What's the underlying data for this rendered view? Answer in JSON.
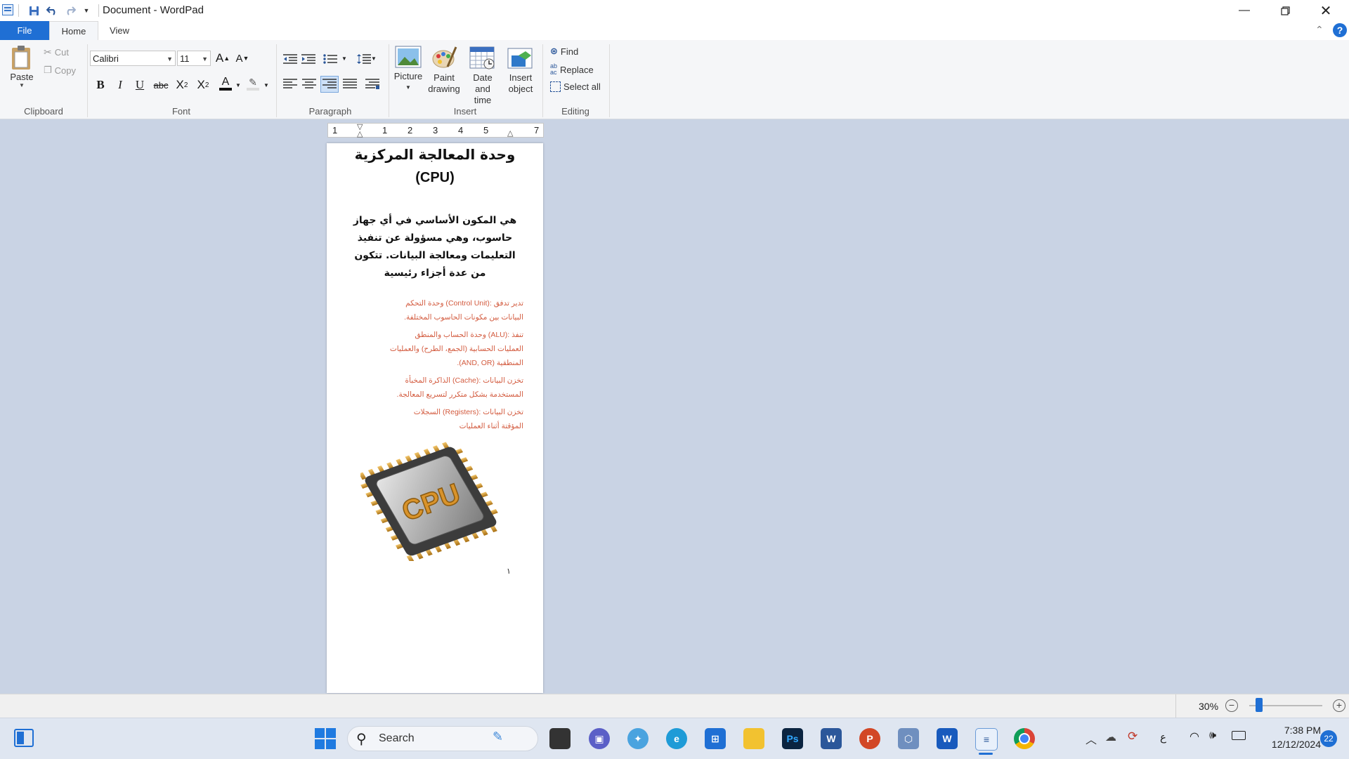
{
  "window": {
    "title": "Document - WordPad"
  },
  "tabs": {
    "file": "File",
    "home": "Home",
    "view": "View"
  },
  "clipboard": {
    "paste": "Paste",
    "cut": "Cut",
    "copy": "Copy",
    "label": "Clipboard"
  },
  "font": {
    "family": "Calibri",
    "size": "11",
    "label": "Font"
  },
  "paragraph": {
    "label": "Paragraph"
  },
  "insert": {
    "picture": "Picture",
    "paint_drawing": [
      "Paint",
      "drawing"
    ],
    "date_time": [
      "Date and",
      "time"
    ],
    "insert_object": [
      "Insert",
      "object"
    ],
    "label": "Insert"
  },
  "editing": {
    "find": "Find",
    "replace": "Replace",
    "select_all": "Select all",
    "label": "Editing"
  },
  "ruler": {
    "ticks": [
      "1",
      "1",
      "2",
      "3",
      "4",
      "5",
      "7"
    ]
  },
  "document": {
    "title_line1": "وحدة المعالجة المركزية",
    "title_line2": "(CPU)",
    "intro": [
      "هي المكون الأساسي في أي جهاز",
      "حاسوب، وهي مسؤولة عن تنفيذ",
      "التعليمات ومعالجة البيانات. تتكون",
      "من عدة أجزاء رئيسية"
    ],
    "items": [
      [
        "تدير تدفق :(Control Unit) وحدة التحكم",
        "البيانات بين مكونات الحاسوب المختلفة."
      ],
      [
        "تنفذ :(ALU) وحدة الحساب والمنطق",
        "العمليات الحسابية (الجمع، الطرح) والعمليات",
        "المنطقية (AND, OR)."
      ],
      [
        "تخزن البيانات :(Cache) الذاكرة المخبأة",
        "المستخدمة بشكل متكرر لتسريع المعالجة."
      ],
      [
        "تخزن البيانات :(Registers) السجلات",
        "المؤقتة أثناء العمليات"
      ]
    ],
    "image_text": "CPU",
    "page_number": "١"
  },
  "status": {
    "zoom": "30%",
    "zoom_level": 0.3
  },
  "taskbar": {
    "search": "Search",
    "time": "7:38 PM",
    "date": "12/12/2024",
    "lang": "ع",
    "notifications": "22"
  },
  "colors": {
    "accent": "#1f6fd4",
    "item_text": "#d35b3f",
    "workspace": "#c9d3e4"
  }
}
